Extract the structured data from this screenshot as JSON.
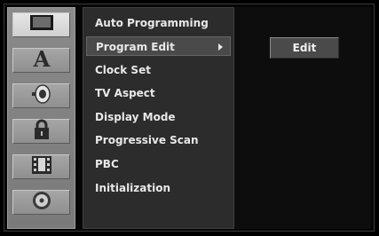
{
  "categories": [
    {
      "icon": "tv-screen-icon",
      "active": true
    },
    {
      "icon": "letter-a-icon",
      "active": false
    },
    {
      "icon": "speaker-icon",
      "active": false
    },
    {
      "icon": "padlock-icon",
      "active": false
    },
    {
      "icon": "film-icon",
      "active": false
    },
    {
      "icon": "disc-icon",
      "active": false
    }
  ],
  "menu": {
    "items": [
      {
        "label": "Auto Programming"
      },
      {
        "label": "Program Edit"
      },
      {
        "label": "Clock Set"
      },
      {
        "label": "TV Aspect"
      },
      {
        "label": "Display Mode"
      },
      {
        "label": "Progressive Scan"
      },
      {
        "label": "PBC"
      },
      {
        "label": "Initialization"
      }
    ],
    "selected_index": 1
  },
  "submenu": {
    "edit_label": "Edit"
  }
}
